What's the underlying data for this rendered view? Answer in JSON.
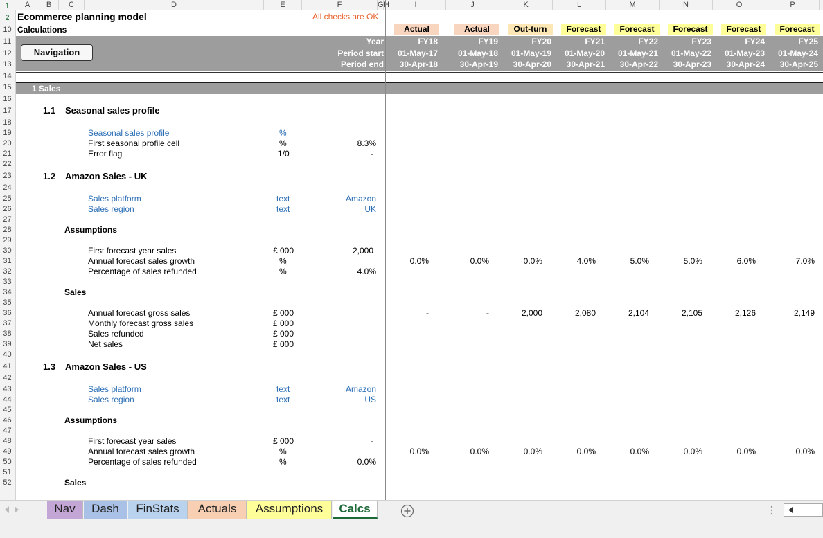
{
  "colors": {
    "actual": "#f8d5bf",
    "outturn": "#fde7b5",
    "forecast": "#ffff99",
    "accent": "#1d6a38",
    "input_blue": "#2c6fb5",
    "check_ok": "#e8622c"
  },
  "columns": [
    "A",
    "B",
    "C",
    "D",
    "E",
    "F",
    "G",
    "H",
    "I",
    "J",
    "K",
    "L",
    "M",
    "N",
    "O",
    "P"
  ],
  "rows": [
    "1",
    "2",
    "10",
    "11",
    "12",
    "13",
    "14",
    "15",
    "16",
    "17",
    "18",
    "19",
    "20",
    "21",
    "22",
    "23",
    "24",
    "25",
    "26",
    "27",
    "28",
    "29",
    "30",
    "31",
    "32",
    "33",
    "34",
    "35",
    "36",
    "37",
    "38",
    "39",
    "40",
    "41",
    "42",
    "43",
    "44",
    "45",
    "46",
    "47",
    "48",
    "49",
    "50",
    "51",
    "52"
  ],
  "title": "Ecommerce planning model",
  "subtitle": "Calculations",
  "checks": "All checks are OK",
  "navigation_button": "Navigation",
  "timeline": {
    "row_labels": [
      "Year",
      "Period start",
      "Period end"
    ],
    "headers": [
      {
        "label": "Actual",
        "year": "FY18",
        "start": "01-May-17",
        "end": "30-Apr-18",
        "kind": "actual"
      },
      {
        "label": "Actual",
        "year": "FY19",
        "start": "01-May-18",
        "end": "30-Apr-19",
        "kind": "actual"
      },
      {
        "label": "Out-turn",
        "year": "FY20",
        "start": "01-May-19",
        "end": "30-Apr-20",
        "kind": "outturn"
      },
      {
        "label": "Forecast",
        "year": "FY21",
        "start": "01-May-20",
        "end": "30-Apr-21",
        "kind": "forecast"
      },
      {
        "label": "Forecast",
        "year": "FY22",
        "start": "01-May-21",
        "end": "30-Apr-22",
        "kind": "forecast"
      },
      {
        "label": "Forecast",
        "year": "FY23",
        "start": "01-May-22",
        "end": "30-Apr-23",
        "kind": "forecast"
      },
      {
        "label": "Forecast",
        "year": "FY24",
        "start": "01-May-23",
        "end": "30-Apr-24",
        "kind": "forecast"
      },
      {
        "label": "Forecast",
        "year": "FY25",
        "start": "01-May-24",
        "end": "30-Apr-25",
        "kind": "forecast"
      }
    ]
  },
  "section1": "1 Sales",
  "s11": {
    "num": "1.1",
    "title": "Seasonal sales profile",
    "r18": {
      "label": "Seasonal sales profile",
      "unit": "%"
    },
    "r19": {
      "label": "First seasonal profile cell",
      "unit": "%",
      "value": "8.3%"
    },
    "r20": {
      "label": "Error flag",
      "unit": "1/0",
      "value": "-"
    }
  },
  "s12": {
    "num": "1.2",
    "title": "Amazon Sales - UK",
    "r24": {
      "label": "Sales platform",
      "unit": "text",
      "value": "Amazon"
    },
    "r25": {
      "label": "Sales region",
      "unit": "text",
      "value": "UK"
    },
    "assumptions": "Assumptions",
    "r29": {
      "label": "First forecast year sales",
      "unit": "£ 000",
      "value": "2,000"
    },
    "r30": {
      "label": "Annual forecast sales growth",
      "unit": "%",
      "series": [
        "0.0%",
        "0.0%",
        "0.0%",
        "4.0%",
        "5.0%",
        "5.0%",
        "6.0%",
        "7.0%"
      ]
    },
    "r31": {
      "label": "Percentage of sales refunded",
      "unit": "%",
      "value": "4.0%"
    },
    "sales": "Sales",
    "r35": {
      "label": "Annual forecast gross sales",
      "unit": "£ 000",
      "series": [
        "-",
        "-",
        "2,000",
        "2,080",
        "2,104",
        "2,105",
        "2,126",
        "2,149"
      ]
    },
    "r36": {
      "label": "Monthly forecast gross sales",
      "unit": "£ 000"
    },
    "r37": {
      "label": "Sales refunded",
      "unit": "£ 000"
    },
    "r38": {
      "label": "Net sales",
      "unit": "£ 000"
    }
  },
  "s13": {
    "num": "1.3",
    "title": "Amazon Sales - US",
    "r42": {
      "label": "Sales platform",
      "unit": "text",
      "value": "Amazon"
    },
    "r43": {
      "label": "Sales region",
      "unit": "text",
      "value": "US"
    },
    "assumptions": "Assumptions",
    "r47": {
      "label": "First forecast year sales",
      "unit": "£ 000",
      "value": "-"
    },
    "r48": {
      "label": "Annual forecast sales growth",
      "unit": "%",
      "series": [
        "0.0%",
        "0.0%",
        "0.0%",
        "0.0%",
        "0.0%",
        "0.0%",
        "0.0%",
        "0.0%"
      ]
    },
    "r49": {
      "label": "Percentage of sales refunded",
      "unit": "%",
      "value": "0.0%"
    },
    "sales": "Sales"
  },
  "sheet_tabs": [
    {
      "label": "Nav",
      "color": "#c3a5d6"
    },
    {
      "label": "Dash",
      "color": "#a9c1e6"
    },
    {
      "label": "FinStats",
      "color": "#b9d3ee"
    },
    {
      "label": "Actuals",
      "color": "#f8cfb3"
    },
    {
      "label": "Assumptions",
      "color": "#ffff99"
    },
    {
      "label": "Calcs",
      "color": "#ffffff"
    }
  ],
  "icons": {
    "prev_sheet": "triangle-left-icon",
    "next_sheet": "triangle-right-icon",
    "add_sheet": "plus-circle-icon",
    "more": "vertical-dots-icon",
    "scroll_left": "scroll-left-icon"
  }
}
